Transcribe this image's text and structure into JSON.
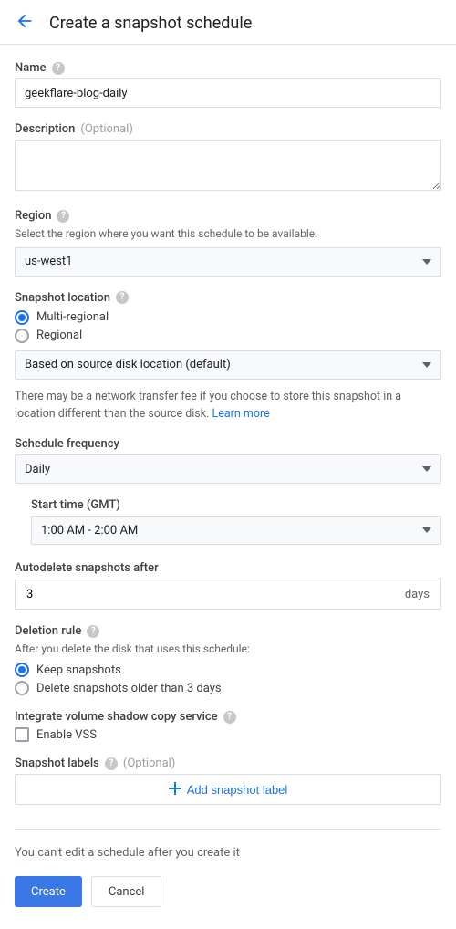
{
  "header": {
    "title": "Create a snapshot schedule"
  },
  "name": {
    "label": "Name",
    "value": "geekflare-blog-daily"
  },
  "description": {
    "label": "Description",
    "optional": "(Optional)",
    "value": ""
  },
  "region": {
    "label": "Region",
    "hint": "Select the region where you want this schedule to be available.",
    "value": "us-west1"
  },
  "snapshotLocation": {
    "label": "Snapshot location",
    "options": {
      "multi": "Multi-regional",
      "regional": "Regional"
    },
    "selected": "multi",
    "basis": "Based on source disk location (default)",
    "info": "There may be a network transfer fee if you choose to store this snapshot in a location different than the source disk. ",
    "learnMore": "Learn more"
  },
  "frequency": {
    "label": "Schedule frequency",
    "value": "Daily"
  },
  "startTime": {
    "label": "Start time (GMT)",
    "value": "1:00 AM - 2:00 AM"
  },
  "autodelete": {
    "label": "Autodelete snapshots after",
    "value": "3",
    "unit": "days"
  },
  "deletionRule": {
    "label": "Deletion rule",
    "hint": "After you delete the disk that uses this schedule:",
    "options": {
      "keep": "Keep snapshots",
      "deleteOlder": "Delete snapshots older than 3 days"
    },
    "selected": "keep"
  },
  "vss": {
    "label": "Integrate volume shadow copy service",
    "checkbox": "Enable VSS"
  },
  "snapshotLabels": {
    "label": "Snapshot labels",
    "optional": "(Optional)",
    "addButton": "Add snapshot label"
  },
  "footer": {
    "warn": "You can't edit a schedule after you create it",
    "create": "Create",
    "cancel": "Cancel"
  }
}
